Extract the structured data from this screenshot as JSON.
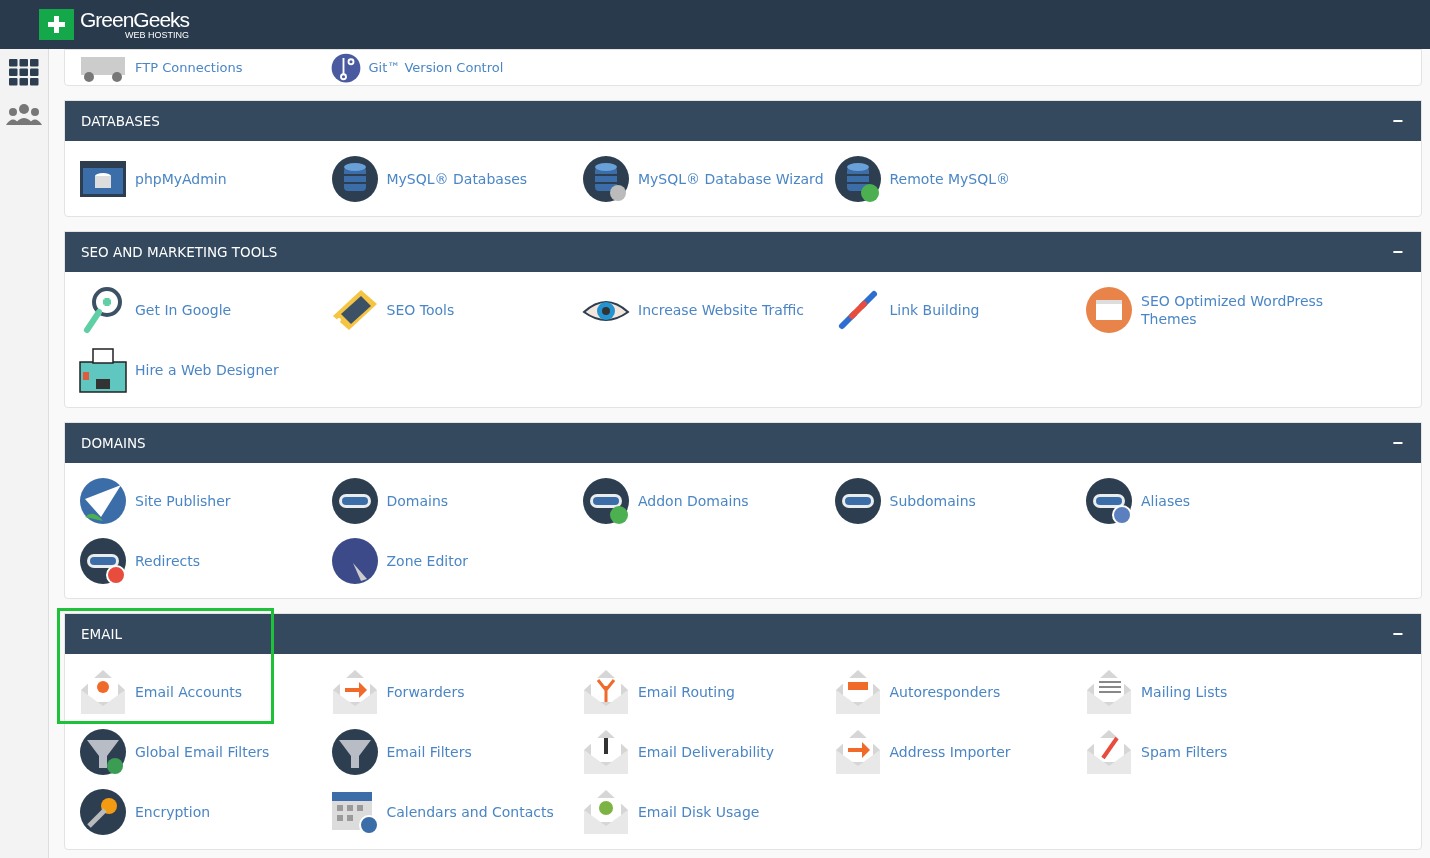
{
  "brand": {
    "name": "GreenGeeks",
    "sub": "WEB HOSTING"
  },
  "top_items": [
    {
      "label": "FTP Connections"
    },
    {
      "label": "Git™ Version Control"
    }
  ],
  "sections": [
    {
      "title": "DATABASES",
      "collapse": "−",
      "items": [
        {
          "label": "phpMyAdmin",
          "highlighted": false
        },
        {
          "label": "MySQL® Databases",
          "highlighted": false
        },
        {
          "label": "MySQL® Database Wizard",
          "highlighted": false
        },
        {
          "label": "Remote MySQL®",
          "highlighted": false
        }
      ]
    },
    {
      "title": "SEO AND MARKETING TOOLS",
      "collapse": "−",
      "items": [
        {
          "label": "Get In Google",
          "highlighted": false
        },
        {
          "label": "SEO Tools",
          "highlighted": false
        },
        {
          "label": "Increase Website Traffic",
          "highlighted": false
        },
        {
          "label": "Link Building",
          "highlighted": false
        },
        {
          "label": "SEO Optimized WordPress Themes",
          "highlighted": false
        },
        {
          "label": "Hire a Web Designer",
          "highlighted": false
        }
      ]
    },
    {
      "title": "DOMAINS",
      "collapse": "−",
      "items": [
        {
          "label": "Site Publisher",
          "highlighted": false
        },
        {
          "label": "Domains",
          "highlighted": false
        },
        {
          "label": "Addon Domains",
          "highlighted": false
        },
        {
          "label": "Subdomains",
          "highlighted": false
        },
        {
          "label": "Aliases",
          "highlighted": false
        },
        {
          "label": "Redirects",
          "highlighted": false
        },
        {
          "label": "Zone Editor",
          "highlighted": false
        }
      ]
    },
    {
      "title": "EMAIL",
      "collapse": "−",
      "items": [
        {
          "label": "Email Accounts",
          "highlighted": true
        },
        {
          "label": "Forwarders",
          "highlighted": false
        },
        {
          "label": "Email Routing",
          "highlighted": false
        },
        {
          "label": "Autoresponders",
          "highlighted": false
        },
        {
          "label": "Mailing Lists",
          "highlighted": false
        },
        {
          "label": "Global Email Filters",
          "highlighted": false
        },
        {
          "label": "Email Filters",
          "highlighted": false
        },
        {
          "label": "Email Deliverability",
          "highlighted": false
        },
        {
          "label": "Address Importer",
          "highlighted": false
        },
        {
          "label": "Spam Filters",
          "highlighted": false
        },
        {
          "label": "Encryption",
          "highlighted": false
        },
        {
          "label": "Calendars and Contacts",
          "highlighted": false
        },
        {
          "label": "Email Disk Usage",
          "highlighted": false
        }
      ]
    }
  ]
}
